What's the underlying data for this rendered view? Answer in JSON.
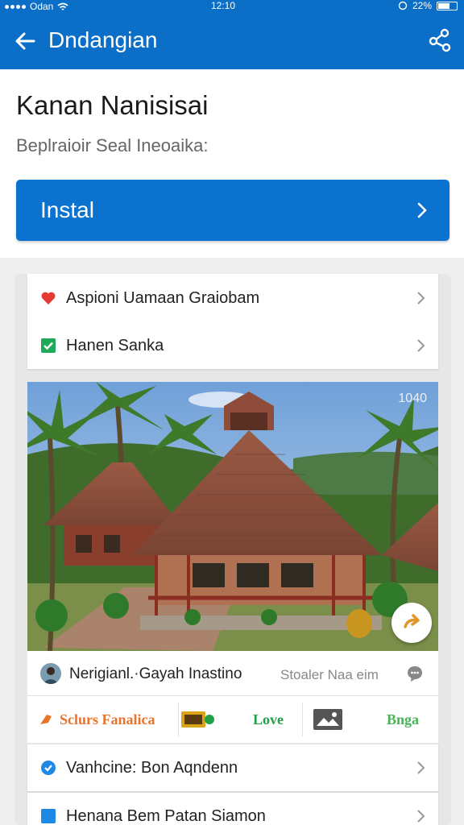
{
  "status_bar": {
    "carrier": "Odan",
    "time": "12:10",
    "battery": "22%"
  },
  "app_bar": {
    "title": "Dndangian",
    "back_icon": "arrow-left-icon",
    "action_icon": "share-icon"
  },
  "header": {
    "title": "Kanan Nanisisai",
    "subtitle": "Beplraioir Seal Ineoaika:",
    "install_label": "Instal"
  },
  "list_top": [
    {
      "label": "Aspioni Uamaan Graiobam",
      "icon": "heart-icon",
      "icon_color": "#e53935"
    },
    {
      "label": "Hanen Sanka",
      "icon": "checkbox-icon",
      "icon_color": "#1faa59"
    }
  ],
  "photo": {
    "badge": "1040",
    "fab_icon": "redo-icon"
  },
  "author": {
    "name": "Nerigianl.·Gayah Inastino",
    "meta": "Stoaler Naa eim",
    "chat_icon": "chat-bubble-icon"
  },
  "actions": [
    {
      "label": "Sclurs Fanalica",
      "color": "#e8742a",
      "icon": "tag-icon"
    },
    {
      "label": "Love",
      "color": "#22a045",
      "icon": "ticket-icon"
    },
    {
      "label": "Bnga",
      "color": "#49b35a",
      "icon": "image-icon"
    }
  ],
  "list_bottom": [
    {
      "label": "Vanhcine: Bon Aqndenn",
      "icon": "shield-check-icon",
      "icon_color": "#1e88e5"
    },
    {
      "label": "Henana Bem Patan Siamon",
      "icon": "square-icon",
      "icon_color": "#1e88e5"
    }
  ],
  "colors": {
    "primary": "#0b6fc7",
    "button": "#0b73cf"
  }
}
